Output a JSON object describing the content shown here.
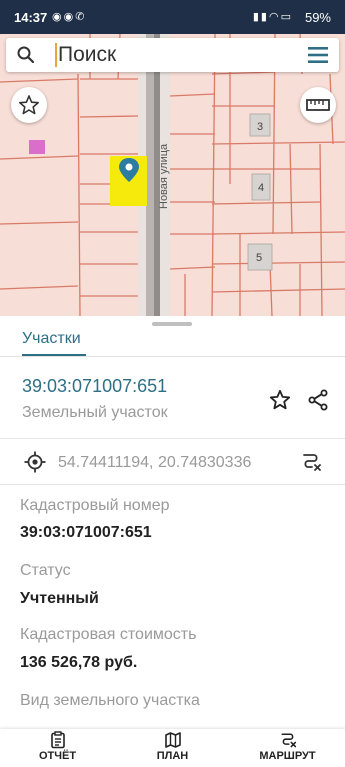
{
  "status_bar": {
    "time": "14:37",
    "battery": "59%",
    "left_icons": [
      "notification-icon",
      "notification-icon",
      "phone-icon"
    ],
    "right_icons": [
      "signal-icon",
      "signal-icon",
      "wifi-icon",
      "battery-icon"
    ]
  },
  "search": {
    "placeholder": "Поиск"
  },
  "map": {
    "house_numbers": [
      "3",
      "4",
      "5"
    ],
    "street_name": "Новая улица",
    "highlight_color": "#f5ea0c",
    "pin_color": "#2a7da0",
    "marker_color": "#d96ecb"
  },
  "panel": {
    "tab_label": "Участки",
    "parcel_number": "39:03:071007:651",
    "parcel_type": "Земельный участок",
    "coordinates": "54.74411194, 20.74830336",
    "fields": [
      {
        "label": "Кадастровый номер",
        "value": "39:03:071007:651"
      },
      {
        "label": "Статус",
        "value": "Учтенный"
      },
      {
        "label": "Кадастровая стоимость",
        "value": "136 526,78 руб."
      },
      {
        "label": "Вид земельного участка",
        "value": ""
      }
    ]
  },
  "bottom_nav": [
    {
      "label": "ОТЧЁТ",
      "icon": "report-icon"
    },
    {
      "label": "ПЛАН",
      "icon": "map-icon"
    },
    {
      "label": "МАРШРУТ",
      "icon": "route-icon"
    }
  ],
  "colors": {
    "accent": "#2f6f86",
    "status_bar": "#1e2f47",
    "map_background": "#f7ded6",
    "parcel_border": "#d97a67"
  }
}
